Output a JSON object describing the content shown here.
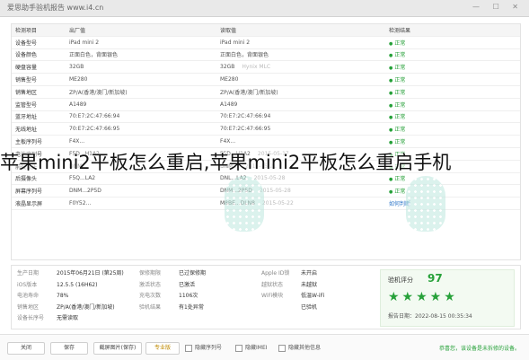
{
  "titlebar": {
    "title": "爱思助手验机报告 www.i4.cn",
    "controls": "— ☐ ✕"
  },
  "table": {
    "headers": [
      "检测项目",
      "出厂值",
      "读取值",
      "检测结果"
    ],
    "rows": [
      {
        "item": "设备型号",
        "factory": "iPad mini 2",
        "read": "iPad mini 2",
        "result": "正常",
        "extra": ""
      },
      {
        "item": "设备颜色",
        "factory": "正面白色，背面银色",
        "read": "正面白色，背面银色",
        "result": "正常",
        "extra": ""
      },
      {
        "item": "硬盘容量",
        "factory": "32GB",
        "read": "32GB",
        "result": "正常",
        "extra": "Hynix MLC"
      },
      {
        "item": "销售型号",
        "factory": "ME280",
        "read": "ME280",
        "result": "正常",
        "extra": ""
      },
      {
        "item": "销售地区",
        "factory": "ZP/A(香港/澳门/新加坡)",
        "read": "ZP/A(香港/澳门/新加坡)",
        "result": "正常",
        "extra": ""
      },
      {
        "item": "监管型号",
        "factory": "A1489",
        "read": "A1489",
        "result": "正常",
        "extra": ""
      },
      {
        "item": "蓝牙地址",
        "factory": "70:E7:2C:47:66:94",
        "read": "70:E7:2C:47:66:94",
        "result": "正常",
        "extra": ""
      },
      {
        "item": "无线地址",
        "factory": "70:E7:2C:47:66:95",
        "read": "70:E7:2C:47:66:95",
        "result": "正常",
        "extra": ""
      },
      {
        "item": "主板序列号",
        "factory": "F4X...",
        "read": "F4X...",
        "result": "正常",
        "extra": ""
      },
      {
        "item": "电池序列号",
        "factory": "F5D...H1A2",
        "read": "F5D...H1A2",
        "result": "正常",
        "extra": "2015-05-17"
      },
      {
        "item": "前摄像头",
        "factory": "DNM...",
        "read": "DNM...",
        "result": "正常",
        "extra": "2015-05-21"
      },
      {
        "item": "后摄像头",
        "factory": "F5Q...LA2",
        "read": "DNL...LA2",
        "result": "正常",
        "extra": "2015-05-28"
      },
      {
        "item": "屏幕序列号",
        "factory": "DNM...2P5D",
        "read": "DNM...2P5D",
        "result": "正常",
        "extra": "2015-05-28"
      },
      {
        "item": "液晶显示屏",
        "factory": "F0Y52...",
        "read": "M8BE...DLN8",
        "result": "如何判断",
        "extra": "2015-05-22"
      }
    ]
  },
  "summary": {
    "rows": [
      [
        "生产日期",
        "2015年06月21日 (第25周)",
        "保修期限",
        "已过保修期",
        "Apple ID锁",
        "未开启"
      ],
      [
        "iOS版本",
        "12.5.5 (16H62)",
        "激活状态",
        "已激活",
        "越狱状态",
        "未越狱"
      ],
      [
        "电池寿命",
        "78%",
        "充电次数",
        "1106次",
        "WiFi模块",
        "低温W-iFi"
      ],
      [
        "销售地区",
        "ZP/A(香港/澳门/新加坡)",
        "验机结果",
        "有1处异常",
        "",
        "已验机"
      ],
      [
        "设备长序号",
        "无需读取",
        "",
        "",
        "",
        ""
      ]
    ],
    "score_label": "验机评分",
    "score": "97",
    "score_stars": "★★★★★",
    "report_date": "报告日期：2022-08-15 00:35:34"
  },
  "footer": {
    "close": "关闭",
    "save": "保存",
    "screenshot": "截屏图片(保存)",
    "pro": "专业版",
    "check_serial": "隐藏序列号",
    "check_imei": "隐藏IMEI",
    "check_other": "隐藏其他信息",
    "note": "恭喜您，该设备是未拆修的设备。"
  },
  "overlay": {
    "headline": "苹果mini2平板怎么重启,苹果mini2平板怎么重启手机"
  }
}
